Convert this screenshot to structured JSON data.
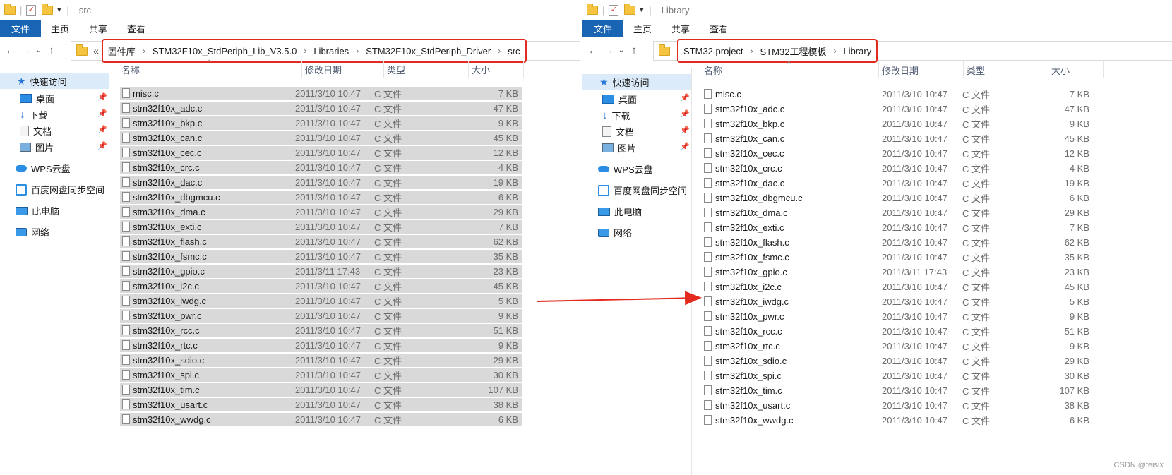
{
  "left": {
    "title": "src",
    "tabs": [
      "文件",
      "主页",
      "共享",
      "查看"
    ],
    "breadcrumb_prefix": "«",
    "breadcrumbs": [
      "固件库",
      "STM32F10x_StdPeriph_Lib_V3.5.0",
      "Libraries",
      "STM32F10x_StdPeriph_Driver",
      "src"
    ]
  },
  "right": {
    "title": "Library",
    "tabs": [
      "文件",
      "主页",
      "共享",
      "查看"
    ],
    "breadcrumbs": [
      "STM32 project",
      "STM32工程模板",
      "Library"
    ]
  },
  "nav": {
    "quick_access": "快速访问",
    "pinned": [
      "桌面",
      "下载",
      "文档",
      "图片"
    ],
    "items": [
      "WPS云盘",
      "百度网盘同步空间",
      "此电脑",
      "网络"
    ]
  },
  "columns": {
    "name": "名称",
    "date": "修改日期",
    "type": "类型",
    "size": "大小"
  },
  "files": [
    {
      "name": "misc.c",
      "date": "2011/3/10 10:47",
      "type": "C 文件",
      "size": "7 KB"
    },
    {
      "name": "stm32f10x_adc.c",
      "date": "2011/3/10 10:47",
      "type": "C 文件",
      "size": "47 KB"
    },
    {
      "name": "stm32f10x_bkp.c",
      "date": "2011/3/10 10:47",
      "type": "C 文件",
      "size": "9 KB"
    },
    {
      "name": "stm32f10x_can.c",
      "date": "2011/3/10 10:47",
      "type": "C 文件",
      "size": "45 KB"
    },
    {
      "name": "stm32f10x_cec.c",
      "date": "2011/3/10 10:47",
      "type": "C 文件",
      "size": "12 KB"
    },
    {
      "name": "stm32f10x_crc.c",
      "date": "2011/3/10 10:47",
      "type": "C 文件",
      "size": "4 KB"
    },
    {
      "name": "stm32f10x_dac.c",
      "date": "2011/3/10 10:47",
      "type": "C 文件",
      "size": "19 KB"
    },
    {
      "name": "stm32f10x_dbgmcu.c",
      "date": "2011/3/10 10:47",
      "type": "C 文件",
      "size": "6 KB"
    },
    {
      "name": "stm32f10x_dma.c",
      "date": "2011/3/10 10:47",
      "type": "C 文件",
      "size": "29 KB"
    },
    {
      "name": "stm32f10x_exti.c",
      "date": "2011/3/10 10:47",
      "type": "C 文件",
      "size": "7 KB"
    },
    {
      "name": "stm32f10x_flash.c",
      "date": "2011/3/10 10:47",
      "type": "C 文件",
      "size": "62 KB"
    },
    {
      "name": "stm32f10x_fsmc.c",
      "date": "2011/3/10 10:47",
      "type": "C 文件",
      "size": "35 KB"
    },
    {
      "name": "stm32f10x_gpio.c",
      "date": "2011/3/11 17:43",
      "type": "C 文件",
      "size": "23 KB"
    },
    {
      "name": "stm32f10x_i2c.c",
      "date": "2011/3/10 10:47",
      "type": "C 文件",
      "size": "45 KB"
    },
    {
      "name": "stm32f10x_iwdg.c",
      "date": "2011/3/10 10:47",
      "type": "C 文件",
      "size": "5 KB"
    },
    {
      "name": "stm32f10x_pwr.c",
      "date": "2011/3/10 10:47",
      "type": "C 文件",
      "size": "9 KB"
    },
    {
      "name": "stm32f10x_rcc.c",
      "date": "2011/3/10 10:47",
      "type": "C 文件",
      "size": "51 KB"
    },
    {
      "name": "stm32f10x_rtc.c",
      "date": "2011/3/10 10:47",
      "type": "C 文件",
      "size": "9 KB"
    },
    {
      "name": "stm32f10x_sdio.c",
      "date": "2011/3/10 10:47",
      "type": "C 文件",
      "size": "29 KB"
    },
    {
      "name": "stm32f10x_spi.c",
      "date": "2011/3/10 10:47",
      "type": "C 文件",
      "size": "30 KB"
    },
    {
      "name": "stm32f10x_tim.c",
      "date": "2011/3/10 10:47",
      "type": "C 文件",
      "size": "107 KB"
    },
    {
      "name": "stm32f10x_usart.c",
      "date": "2011/3/10 10:47",
      "type": "C 文件",
      "size": "38 KB"
    },
    {
      "name": "stm32f10x_wwdg.c",
      "date": "2011/3/10 10:47",
      "type": "C 文件",
      "size": "6 KB"
    }
  ],
  "watermark": "CSDN @feisix",
  "colors": {
    "highlight": "#e42a1f",
    "selection": "#d9d9d9",
    "file_tab": "#1a64b4"
  }
}
